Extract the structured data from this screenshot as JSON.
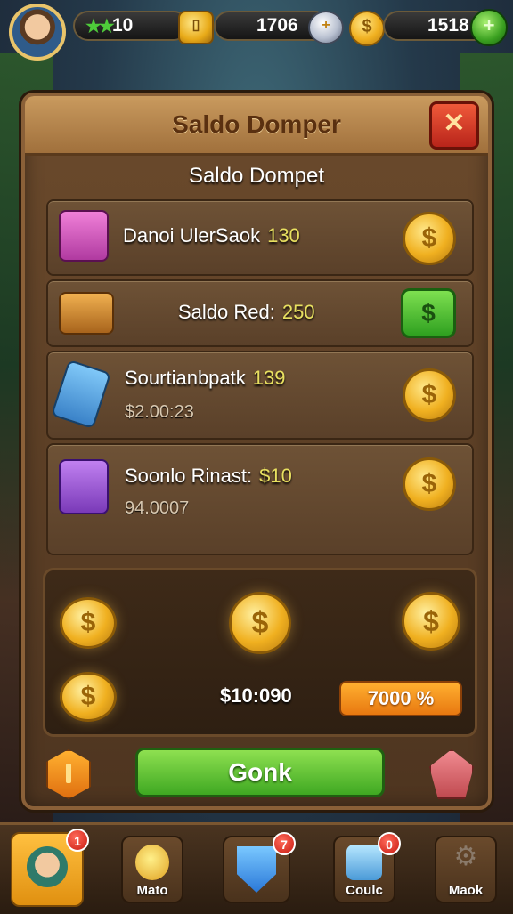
{
  "topbar": {
    "stars": "★★",
    "stars_value": "10",
    "coins_value": "1706",
    "cash_value": "1518"
  },
  "panel": {
    "title": "Saldo Domper",
    "close_label": "✕",
    "subtitle": "Saldo Dompet"
  },
  "rows": [
    {
      "label": "Danoi UlerSaok",
      "amount": "130",
      "sub": ""
    },
    {
      "label": "Saldo Red:",
      "amount": "250",
      "sub": ""
    },
    {
      "label": "Sourtianbpatk",
      "amount": "139",
      "sub": "$2.00:23"
    },
    {
      "label": "Soonlo Rinast:",
      "amount": "$10",
      "sub": "94.0007"
    }
  ],
  "coin_symbol": "$",
  "coin_box": {
    "total": "$10:090",
    "button_label": "7000 %"
  },
  "main_button": "Gonk",
  "nav": [
    {
      "label": "",
      "badge": "1"
    },
    {
      "label": "Mato",
      "badge": ""
    },
    {
      "label": "",
      "badge": "7"
    },
    {
      "label": "Coulc",
      "badge": "0"
    },
    {
      "label": "Maok",
      "badge": ""
    }
  ],
  "colors": {
    "accent_gold": "#f0b020",
    "button_green": "#3fa822",
    "close_red": "#b8241a",
    "button_orange": "#e87810"
  }
}
